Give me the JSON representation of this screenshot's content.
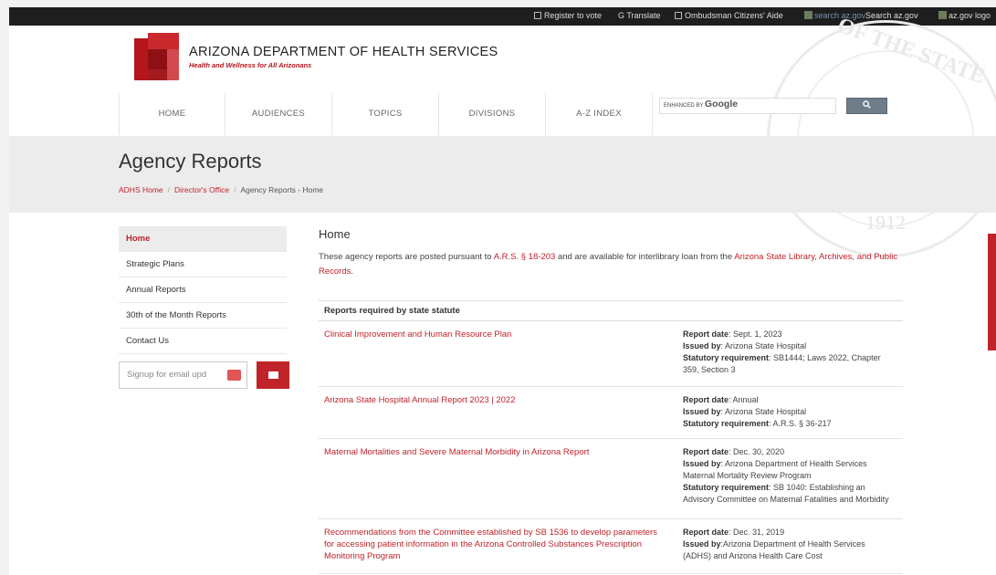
{
  "topbar": {
    "register": "Register to vote",
    "translate": "Translate",
    "ombudsman": "Ombudsman Citizens' Aide",
    "search_img_alt": "search az.gov",
    "search_text": "Search az.gov",
    "azgov_img_alt": "az.gov logo"
  },
  "header": {
    "org_name": "ARIZONA DEPARTMENT OF HEALTH SERVICES",
    "tagline": "Health and Wellness for All Arizonans",
    "seal_motto": "OF THE STATE",
    "seal_year": "1912"
  },
  "nav": {
    "items": [
      "HOME",
      "AUDIENCES",
      "TOPICS",
      "DIVISIONS",
      "A-Z INDEX"
    ]
  },
  "search": {
    "enhanced_by": "ENHANCED BY",
    "brand": "Google",
    "button_icon": "search-icon"
  },
  "banner": {
    "title": "Agency Reports",
    "breadcrumb": [
      "ADHS Home",
      "Director's Office",
      "Agency Reports - Home"
    ]
  },
  "sidebar": {
    "items": [
      "Home",
      "Strategic Plans",
      "Annual Reports",
      "30th of the Month Reports",
      "Contact Us"
    ],
    "active_index": 0,
    "email_placeholder": "Signup for email upd",
    "email_button_icon": "envelope-icon"
  },
  "main": {
    "heading": "Home",
    "intro_before": "These agency reports are posted pursuant to ",
    "intro_link1": "A.R.S. § 18-203",
    "intro_middle": " and are available for interlibrary loan from the ",
    "intro_link2": "Arizona State Library, Archives, and Public Records",
    "intro_after": ".",
    "table_header": "Reports required by state statute",
    "labels": {
      "date": "Report date",
      "issued": "Issued by",
      "statutory": "Statutory requirement"
    },
    "reports": [
      {
        "title": "Clinical Improvement and Human Resource Plan",
        "date": "Sept. 1, 2023",
        "issued_by": "Arizona State Hospital",
        "statutory": "SB1444; Laws 2022, Chapter 359, Section 3"
      },
      {
        "title": "Arizona State Hospital Annual Report 2023 | 2022",
        "date": "Annual",
        "issued_by": "Arizona State Hospital",
        "statutory": "A.R.S. § 36-217"
      },
      {
        "title": "Maternal Mortalities and Severe Maternal Morbidity in Arizona Report",
        "date": "Dec. 30, 2020",
        "issued_by": "Arizona Department of Health Services Maternal Mortality Review Program",
        "statutory": "SB 1040: Establishing an Advisory Committee on Maternal Fatalities and Morbidity"
      },
      {
        "title": "Recommendations from the Committee established by SB 1536 to develop parameters for accessing patient information in the Arizona Controlled Substances Prescription Monitoring Program",
        "date": "Dec. 31, 2019",
        "issued_by": "Arizona Department of Health Services (ADHS) and Arizona Health Care Cost"
      }
    ]
  },
  "colors": {
    "accent": "#c0232a",
    "topbar": "#1e1e1e",
    "banner": "#ececec"
  }
}
